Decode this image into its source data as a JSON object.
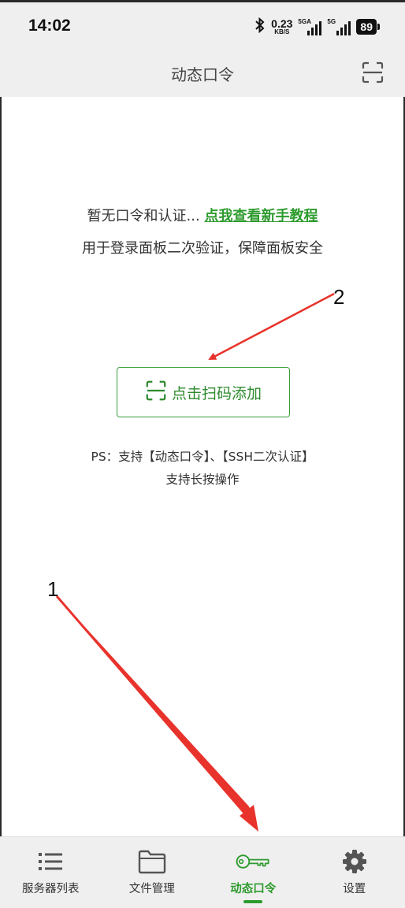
{
  "status_bar": {
    "time": "14:02",
    "net_speed_value": "0.23",
    "net_speed_unit": "KB/S",
    "sim1_label": "5GA",
    "sim2_label": "5G",
    "battery": "89",
    "bluetooth_icon": "bluetooth-icon"
  },
  "app_bar": {
    "title": "动态口令",
    "scan_icon": "scan-icon"
  },
  "empty_state": {
    "line1_prefix": "暂无口令和认证...",
    "tutorial_link": "点我查看新手教程",
    "line2": "用于登录面板二次验证，保障面板安全",
    "scan_button_label": "点击扫码添加",
    "ps_line1": "PS：支持【动态口令】、【SSH二次认证】",
    "ps_line2": "支持长按操作"
  },
  "annotations": {
    "marker1": "1",
    "marker2": "2",
    "arrow_color": "#e8332c"
  },
  "bottom_nav": {
    "items": [
      {
        "label": "服务器列表",
        "icon": "list-icon",
        "active": false
      },
      {
        "label": "文件管理",
        "icon": "folder-icon",
        "active": false
      },
      {
        "label": "动态口令",
        "icon": "key-icon",
        "active": true
      },
      {
        "label": "设置",
        "icon": "gear-icon",
        "active": false
      }
    ]
  },
  "colors": {
    "accent": "#2e9b2e",
    "bar_background": "#efefef"
  }
}
